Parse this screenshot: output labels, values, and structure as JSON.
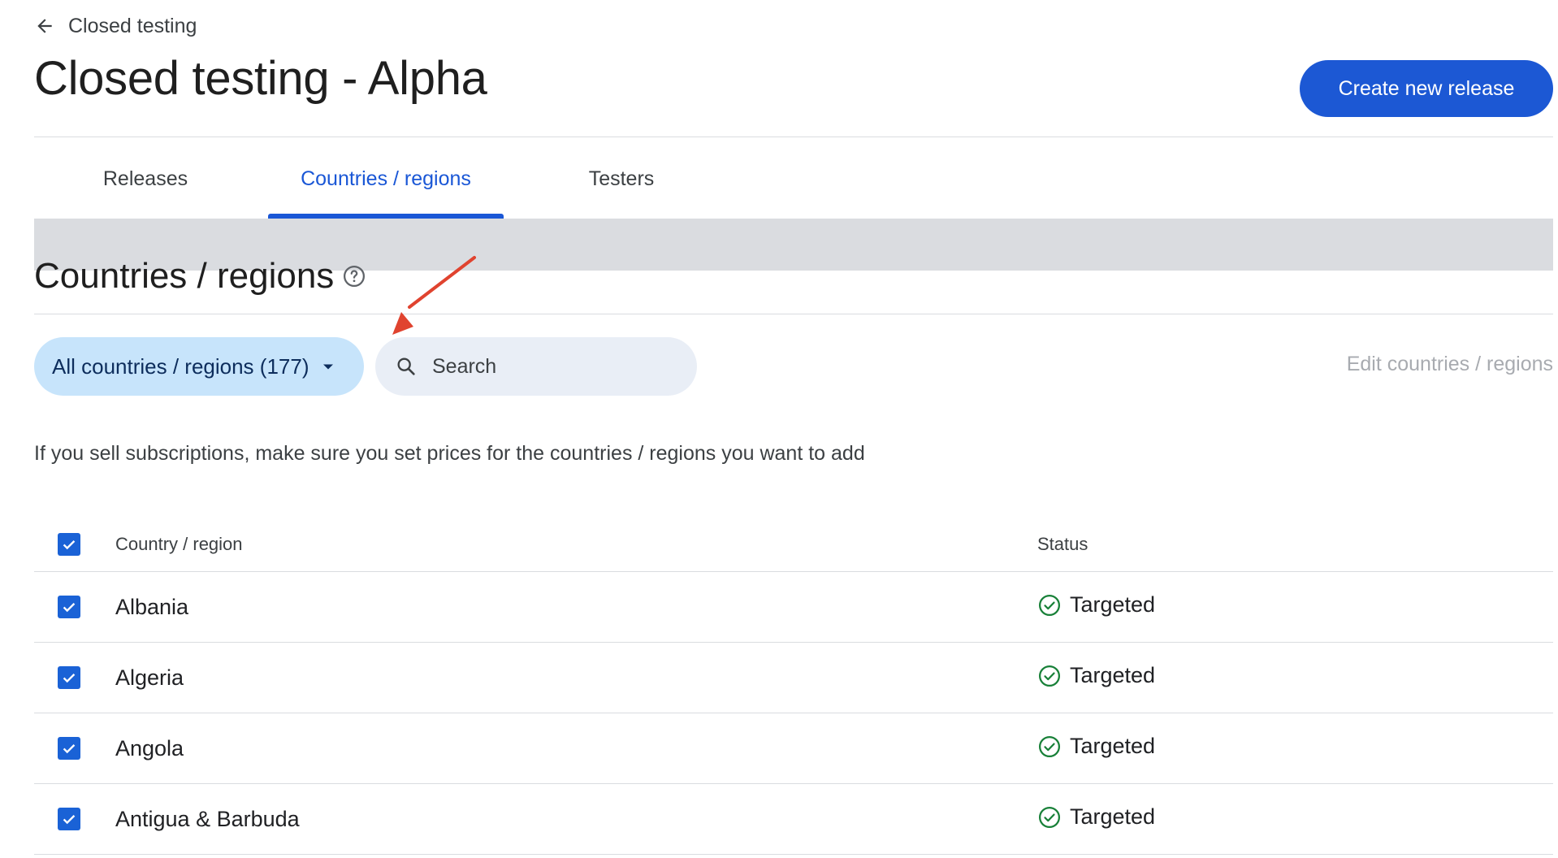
{
  "header": {
    "back_label": "Closed testing",
    "title": "Closed testing - Alpha",
    "create_button": "Create new release"
  },
  "tabs": [
    {
      "label": "Releases",
      "active": false
    },
    {
      "label": "Countries / regions",
      "active": true
    },
    {
      "label": "Testers",
      "active": false
    }
  ],
  "section": {
    "title": "Countries / regions",
    "help_icon": "help-circle-icon"
  },
  "filter": {
    "label": "All countries / regions (177)",
    "icon": "caret-down-icon"
  },
  "search": {
    "placeholder": "Search",
    "value": "",
    "icon": "search-icon"
  },
  "edit_link": "Edit countries / regions",
  "notice": "If you sell subscriptions, make sure you set prices for the countries / regions you want to add",
  "table": {
    "columns": [
      "Country / region",
      "Status"
    ],
    "rows": [
      {
        "country": "Albania",
        "status": "Targeted",
        "checked": true
      },
      {
        "country": "Algeria",
        "status": "Targeted",
        "checked": true
      },
      {
        "country": "Angola",
        "status": "Targeted",
        "checked": true
      },
      {
        "country": "Antigua & Barbuda",
        "status": "Targeted",
        "checked": true
      }
    ]
  },
  "colors": {
    "primary": "#1c58d4",
    "active_tab": "#1a57d6",
    "chip_bg": "#c7e4fb",
    "search_bg": "#e9eef6",
    "targeted_green": "#188038",
    "annotation_arrow": "#e0432f"
  }
}
